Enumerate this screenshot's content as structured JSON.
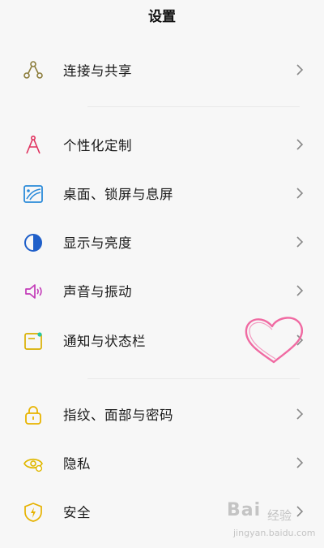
{
  "header": {
    "title": "设置"
  },
  "colors": {
    "accent_chevron": "#8a8a8a",
    "heart": "#f06aa2"
  },
  "items": [
    {
      "label": "连接与共享",
      "icon": "share-nodes-icon",
      "color": "#8b7c3a"
    },
    {
      "label": "个性化定制",
      "icon": "compass-icon",
      "color": "#e0325f"
    },
    {
      "label": "桌面、锁屏与息屏",
      "icon": "wallpaper-icon",
      "color": "#2a8ad9"
    },
    {
      "label": "显示与亮度",
      "icon": "brightness-icon",
      "color": "#1f5fc9"
    },
    {
      "label": "声音与振动",
      "icon": "speaker-icon",
      "color": "#c33bb8"
    },
    {
      "label": "通知与状态栏",
      "icon": "notification-bar-icon",
      "color": "#d9b000"
    },
    {
      "label": "指纹、面部与密码",
      "icon": "lock-icon",
      "color": "#e8b400"
    },
    {
      "label": "隐私",
      "icon": "privacy-eye-icon",
      "color": "#e0b800"
    },
    {
      "label": "安全",
      "icon": "security-shield-icon",
      "color": "#e6b200"
    }
  ],
  "watermark": {
    "brand": "Bai",
    "brand_suffix": "经验",
    "url": "jingyan.baidu.com"
  }
}
